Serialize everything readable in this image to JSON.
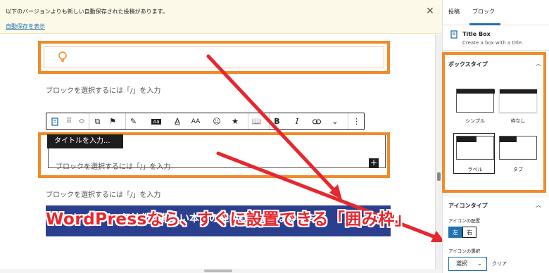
{
  "notice": {
    "message": "以下のバージョンよりも新しい自動保存された投稿があります。",
    "link": "自動保存を表示",
    "close_icon": "close-icon"
  },
  "editor": {
    "placeholder": "ブロックを選択するには「/」を入力",
    "title_tooltip": "タイトルを入力...",
    "inner_placeholder": "ブロックを選択するには「/」を入力",
    "placeholder_below": "ブロックを選択するには「/」を入力",
    "headline": "はてなブログで収益化が難しい本当の理由❸【はてなのコミュ",
    "add_block": "+"
  },
  "toolbar": {
    "icons": [
      "title-box-icon",
      "drag-handle-icon",
      "move-up-down-icon",
      "transform-icon",
      "highlight-icon",
      "pen-icon",
      "inline-code-icon",
      "text-color-icon",
      "font-size-icon",
      "emoji-icon",
      "star-icon",
      "book-icon",
      "bold-icon",
      "italic-icon",
      "link-icon",
      "chevron-down-icon",
      "more-options-icon"
    ],
    "bold": "B",
    "italic": "I",
    "more": "⋮",
    "font_size": "AA",
    "text_color": "A",
    "code": "Aa"
  },
  "overlay_caption": "WordPressなら、すぐに設置できる「囲み枠」",
  "sidebar": {
    "tabs": [
      "投稿",
      "ブロック"
    ],
    "active_tab": "ブロック",
    "block_title": "Title Box",
    "block_desc": "Create a box with a title.",
    "box_type_title": "ボックスタイプ",
    "box_types": [
      "シンプル",
      "枠なし",
      "ラベル",
      "タブ"
    ],
    "selected_box_type": "ラベル",
    "icon_type_title": "アイコンタイプ",
    "icon_position_label": "アイコンの配置",
    "icon_positions": [
      "左",
      "右"
    ],
    "icon_select_label": "アイコンの選択",
    "select_value": "選択",
    "clear_label": "クリア"
  },
  "colors": {
    "accent": "#2271b1",
    "highlight_orange": "#f08b2c",
    "arrow_red": "#e8262d",
    "headline_blue": "#2b3f8f"
  }
}
